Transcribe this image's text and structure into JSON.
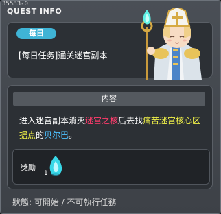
{
  "header": {
    "quest_id": "35583-0",
    "title": "QUEST INFO"
  },
  "quest": {
    "category_badge": "每日",
    "name": "[每日任务]通关迷宫副本"
  },
  "content": {
    "header": "内容",
    "desc_part1": "进入迷宫副本消灭",
    "target_boss": "迷宫之核",
    "desc_part2": "后去找",
    "target_npc_location": "痛苦迷宫核心区据点",
    "desc_part3": "的",
    "target_npc": "贝尔巴",
    "desc_end": "。"
  },
  "reward": {
    "label": "獎勵",
    "count": "1",
    "icon": "cyan-flame-icon"
  },
  "status": {
    "text": "狀態: 可開始 / 不可執行任務"
  },
  "colors": {
    "badge": "#3fb4d6",
    "highlight_red": "#ff3c6c",
    "highlight_yellow": "#f0f048",
    "highlight_blue": "#4cc0ff"
  }
}
